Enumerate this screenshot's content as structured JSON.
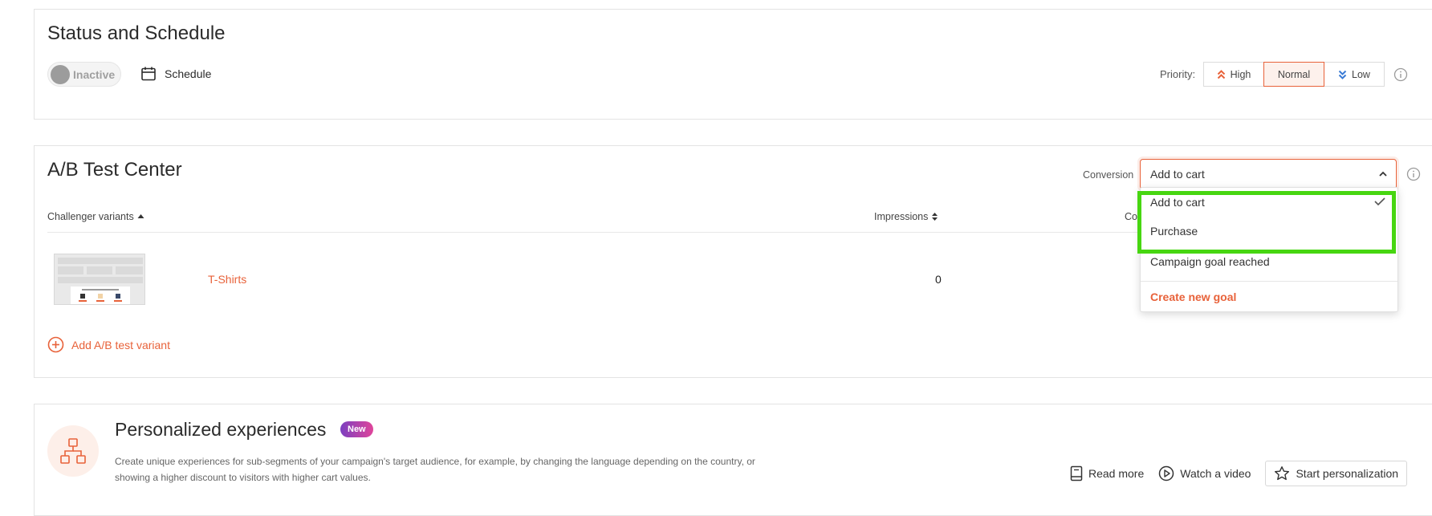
{
  "status_section": {
    "title": "Status and Schedule",
    "toggle_label": "Inactive",
    "schedule_label": "Schedule",
    "priority_label": "Priority:",
    "priority_options": [
      "High",
      "Normal",
      "Low"
    ],
    "priority_selected": "Normal"
  },
  "ab_section": {
    "title": "A/B Test Center",
    "conversion_label": "Conversion",
    "conversion_selected": "Add to cart",
    "columns": {
      "variants": "Challenger variants",
      "impressions": "Impressions",
      "conversion": "Conversio"
    },
    "rows": [
      {
        "name": "T-Shirts",
        "impressions": "0"
      }
    ],
    "add_variant_label": "Add A/B test variant",
    "dropdown": {
      "items": [
        "Add to cart",
        "Purchase",
        "Campaign goal reached"
      ],
      "create_label": "Create new goal"
    }
  },
  "personalization": {
    "title": "Personalized experiences",
    "badge": "New",
    "description": "Create unique experiences for sub-segments of your campaign's target audience, for example, by changing the language depending on the country, or showing a higher discount to visitors with higher cart values.",
    "read_more": "Read more",
    "watch_video": "Watch a video",
    "start_label": "Start personalization"
  },
  "colors": {
    "accent": "#e8623a",
    "highlight": "#47d611"
  }
}
